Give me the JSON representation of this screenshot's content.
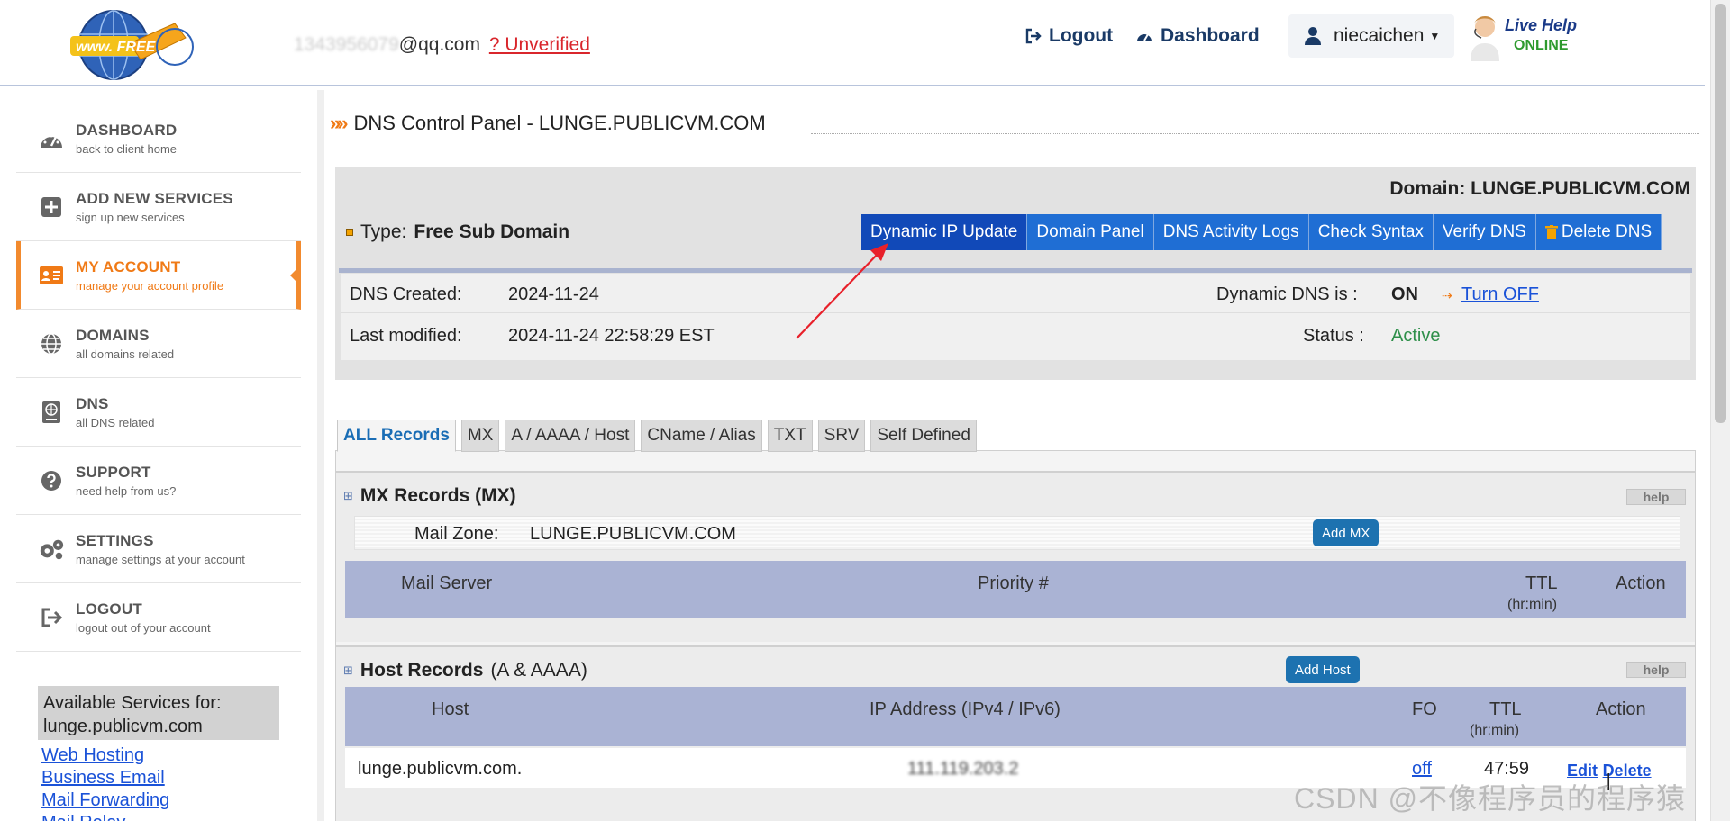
{
  "header": {
    "logo_text": "www. FREE",
    "email_masked": "1343956079",
    "email_domain": "@qq.com",
    "unverified_label": "? Unverified",
    "logout_label": "Logout",
    "dashboard_label": "Dashboard",
    "username": "niecaichen",
    "live_help_title": "Live Help",
    "live_help_status": "ONLINE"
  },
  "sidebar": {
    "items": [
      {
        "title": "DASHBOARD",
        "subtitle": "back to client home",
        "icon": "speedometer-icon"
      },
      {
        "title": "ADD NEW SERVICES",
        "subtitle": "sign up new services",
        "icon": "plus-square-icon"
      },
      {
        "title": "MY ACCOUNT",
        "subtitle": "manage your account profile",
        "icon": "id-card-icon"
      },
      {
        "title": "DOMAINS",
        "subtitle": "all domains related",
        "icon": "globe-icon"
      },
      {
        "title": "DNS",
        "subtitle": "all DNS related",
        "icon": "dns-server-icon"
      },
      {
        "title": "SUPPORT",
        "subtitle": "need help from us?",
        "icon": "question-circle-icon"
      },
      {
        "title": "SETTINGS",
        "subtitle": "manage settings at your account",
        "icon": "gears-icon"
      },
      {
        "title": "LOGOUT",
        "subtitle": "logout out of your account",
        "icon": "sign-out-icon"
      }
    ],
    "available_title": "Available Services for:",
    "available_domain": "lunge.publicvm.com",
    "service_links": [
      "Web Hosting",
      "Business Email",
      "Mail Forwarding",
      "Mail Relay"
    ]
  },
  "main": {
    "page_title": "DNS Control Panel - LUNGE.PUBLICVM.COM",
    "domain_label": "Domain: LUNGE.PUBLICVM.COM",
    "type_label": "Type:",
    "type_value": "Free Sub Domain",
    "buttons": [
      "Dynamic IP Update",
      "Domain Panel",
      "DNS Activity Logs",
      "Check Syntax",
      "Verify DNS",
      "Delete DNS"
    ],
    "dns_created_label": "DNS Created:",
    "dns_created_value": "2024-11-24",
    "last_modified_label": "Last modified:",
    "last_modified_value": "2024-11-24 22:58:29 EST",
    "dynamic_dns_label": "Dynamic DNS is :",
    "dynamic_dns_value": "ON",
    "turn_off_label": "Turn OFF",
    "status_label": "Status :",
    "status_value": "Active",
    "accent_color": "#1149b8",
    "active_color": "#2e8f4a"
  },
  "tabs": [
    "ALL Records",
    "MX",
    "A / AAAA / Host",
    "CName / Alias",
    "TXT",
    "SRV",
    "Self Defined"
  ],
  "mx_section": {
    "title_bold": "MX Records (MX)",
    "help_label": "help",
    "mail_zone_label": "Mail Zone:",
    "mail_zone_value": "LUNGE.PUBLICVM.COM",
    "add_button": "Add MX",
    "columns": {
      "mail_server": "Mail Server",
      "priority": "Priority #",
      "ttl": "TTL",
      "ttl_sub": "(hr:min)",
      "action": "Action"
    }
  },
  "host_section": {
    "title_bold": "Host Records",
    "title_rest": "(A & AAAA)",
    "help_label": "help",
    "add_button": "Add Host",
    "columns": {
      "host": "Host",
      "ip": "IP Address (IPv4 / IPv6)",
      "fo": "FO",
      "ttl": "TTL",
      "ttl_sub": "(hr:min)",
      "action": "Action"
    },
    "rows": [
      {
        "host": "lunge.publicvm.com.",
        "ip_masked": "111.119.203.2",
        "fo": "off",
        "ttl": "47:59",
        "edit": "Edit",
        "sep": "|",
        "delete": "Delete"
      }
    ]
  },
  "watermark": "CSDN @不像程序员的程序猿"
}
